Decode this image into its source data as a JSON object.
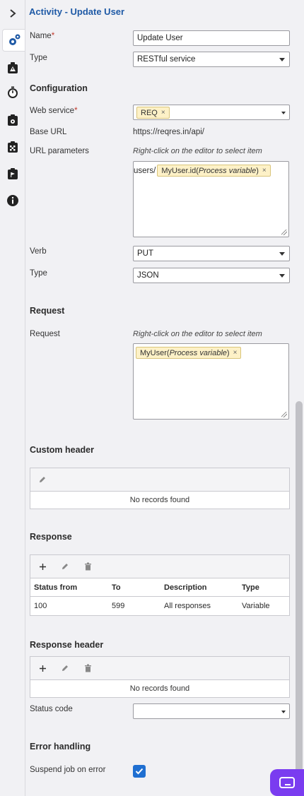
{
  "panel": {
    "title": "Activity - Update User"
  },
  "fields": {
    "name": {
      "label": "Name",
      "required": "*",
      "value": "Update User"
    },
    "type": {
      "label": "Type",
      "value": "RESTful service"
    }
  },
  "configuration": {
    "heading": "Configuration",
    "web_service": {
      "label": "Web service",
      "required": "*",
      "chip": "REQ",
      "chip_remove": "×"
    },
    "base_url": {
      "label": "Base URL",
      "value": "https://reqres.in/api/"
    },
    "url_parameters": {
      "label": "URL parameters",
      "hint": "Right-click on the editor to select item",
      "prefix": "users/",
      "chip_name": "MyUser.id",
      "chip_open": " (",
      "chip_kind": "Process variable",
      "chip_close": ")",
      "chip_remove": "×"
    },
    "verb": {
      "label": "Verb",
      "value": "PUT"
    },
    "type": {
      "label": "Type",
      "value": "JSON"
    }
  },
  "request": {
    "heading": "Request",
    "label": "Request",
    "hint": "Right-click on the editor to select item",
    "chip_name": "MyUser",
    "chip_open": " (",
    "chip_kind": "Process variable",
    "chip_close": ")",
    "chip_remove": "×"
  },
  "custom_header": {
    "heading": "Custom header",
    "empty": "No records found"
  },
  "response": {
    "heading": "Response",
    "columns": [
      "Status from",
      "To",
      "Description",
      "Type"
    ],
    "rows": [
      {
        "status_from": "100",
        "to": "599",
        "description": "All responses",
        "type": "Variable"
      }
    ]
  },
  "response_header": {
    "heading": "Response header",
    "empty": "No records found",
    "status_code_label": "Status code",
    "status_code_value": ""
  },
  "error_handling": {
    "heading": "Error handling",
    "suspend_label": "Suspend job on error",
    "suspend_checked": true
  },
  "rail": {
    "icons": [
      "chevron-right-icon",
      "gears-icon",
      "warning-bag-icon",
      "stopwatch-icon",
      "clipboard-gear-icon",
      "checkered-clipboard-icon",
      "flag-clipboard-icon",
      "info-icon"
    ]
  },
  "colors": {
    "accent": "#1f5aa6",
    "checkbox": "#1f6fd1",
    "chip_bg": "#fdf1c7",
    "fab": "#7a3cf0"
  }
}
